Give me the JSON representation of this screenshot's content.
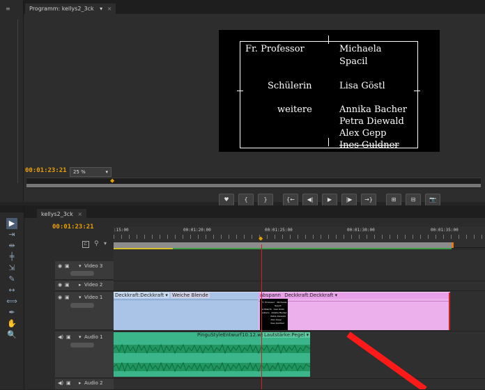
{
  "program_monitor": {
    "tab_label": "Programm: kellys2_3ck",
    "tab_menu": "▾",
    "timecode": "00:01:23:21",
    "zoom": "25 %",
    "credits": [
      {
        "role": "Fr. Professor",
        "names": [
          "Michaela",
          "Spacil"
        ]
      },
      {
        "role": "Schülerin",
        "names": [
          "Lisa Göstl"
        ]
      },
      {
        "role": "weitere",
        "names": [
          "Annika Bacher",
          "Petra Diewald",
          "Alex Gepp",
          "Ines Guldner"
        ]
      }
    ],
    "transport_buttons": [
      "♥",
      "{",
      "}",
      "{←",
      "◀|",
      "▶",
      "|▶",
      "→}",
      "⊞",
      "⊟",
      "📷"
    ]
  },
  "timeline": {
    "tab_label": "kellys2_3ck",
    "timecode": "00:01:23:21",
    "ruler": [
      ":15:00",
      "00:01:20:00",
      "00:01:25:00",
      "00:01:30:00",
      "00:01:35:00"
    ],
    "tracks": {
      "video3": "Video 3",
      "video2": "Video 2",
      "video1": "Video 1",
      "audio1": "Audio 1",
      "audio2": "Audio 2"
    },
    "clips": {
      "v1_a_label": "Deckkraft:Deckkraft ▾",
      "v1_transition": "Weiche Blende",
      "v1_b_name": "abspann",
      "v1_b_label": "Deckkraft:Deckkraft ▾",
      "a1_name": "PinguStyleEntwurf10.12.wav",
      "a1_label": "Lautstärke:Pegel ▾"
    },
    "mini_credits": [
      "Fr. Professor   Michaela",
      "                    Spacil",
      "Schülerin   Lisa Göstl",
      "weitere   Annika Bacher",
      "              Petra Diewald",
      "              Alex Gepp",
      "              Ines Guldner"
    ]
  },
  "colors": {
    "accent_timecode": "#e8a000",
    "clip_video_blue": "#a9c4e6",
    "clip_video_pink": "#ecb0ec",
    "clip_audio_green": "#3ab68a",
    "playhead": "#d02020",
    "annotation_arrow": "#ff1a1a"
  }
}
